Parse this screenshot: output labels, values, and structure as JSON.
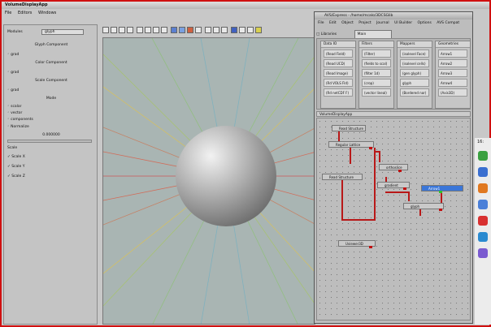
{
  "app": {
    "title": "VolumeDisplayApp",
    "menu": [
      "File",
      "Editors",
      "Windows"
    ]
  },
  "left_panel": {
    "modules_label": "Modules",
    "modules_value": "glyph",
    "glyph_component": "Glyph Component",
    "color_component": "Color Component",
    "scale_component": "Scale Component",
    "mode": "Mode",
    "grad": "grad",
    "options": [
      "scalar",
      "vector",
      "components",
      "Normalize"
    ],
    "value": "0.000000",
    "scale_label": "Scale",
    "scale_axes": [
      "Scale X",
      "Scale Y",
      "Scale Z"
    ]
  },
  "avs": {
    "title": "AVS/Express - /home/mcalo/3DCSGlib",
    "menu": [
      "File",
      "Edit",
      "Object",
      "Project",
      "Journal",
      "UI Builder",
      "Options",
      "AVS Compat"
    ],
    "libraries_label": "Libraries",
    "libraries_value": "Main",
    "lib_columns": [
      {
        "name": "Data IO",
        "items": [
          "(Read Field)",
          "(Read UCD)",
          "(Read Image)",
          "(Rd VOLS Fld)",
          "(Rd netCDF F)"
        ]
      },
      {
        "name": "Filters",
        "items": [
          "(Filter)",
          "(fields to scal)",
          "(filter 1d)",
          "(crop)",
          "(vector lineal)"
        ]
      },
      {
        "name": "Mappers",
        "items": [
          "(isolevel Face)",
          "(isolevel cells)",
          "(gen glyph)",
          "glyph",
          "(Bordered nor)"
        ]
      },
      {
        "name": "Geometries",
        "items": [
          "Arrow1",
          "Arrow2",
          "Arrow3",
          "Arrow4",
          "(Axis3D)"
        ]
      }
    ],
    "network_title": "VolumeDisplayApp",
    "modules": [
      {
        "label": "Read Structure"
      },
      {
        "label": "Regular Lattice"
      },
      {
        "label": "Read Structure"
      },
      {
        "label": "orthoslice"
      },
      {
        "label": "gradient"
      },
      {
        "label": "Arrow1"
      },
      {
        "label": "glyph"
      },
      {
        "label": "Uviewer3D"
      }
    ]
  },
  "taskbar": {
    "clock": "16:"
  }
}
